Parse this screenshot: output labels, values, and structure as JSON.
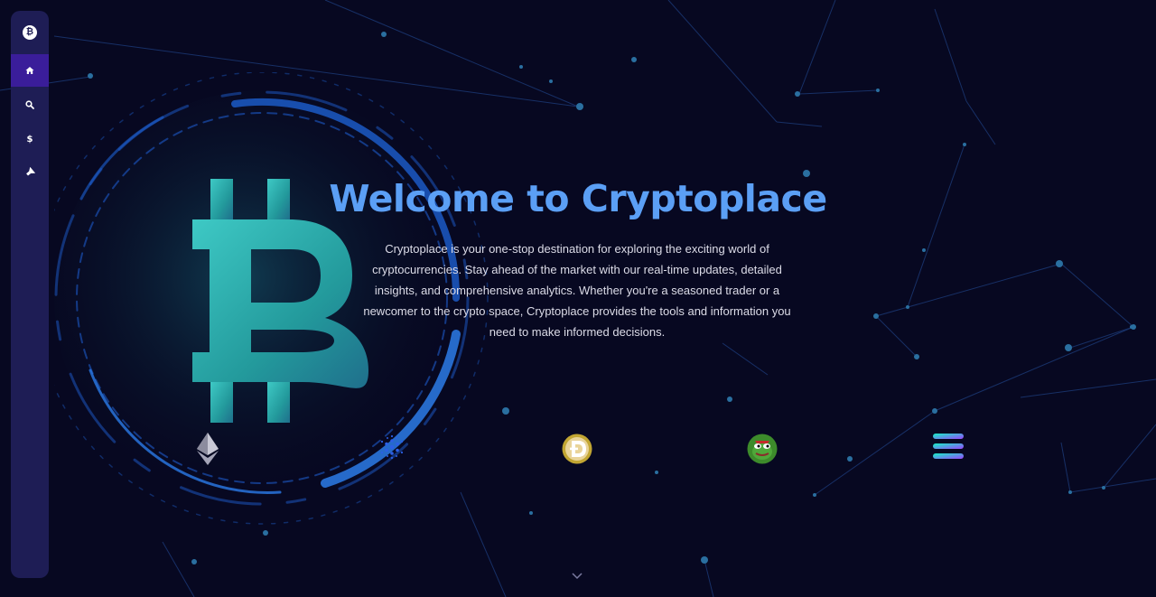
{
  "sidebar": {
    "logo": "bitcoin-icon",
    "items": [
      {
        "name": "home",
        "icon": "home-icon",
        "active": true
      },
      {
        "name": "search",
        "icon": "search-icon",
        "active": false
      },
      {
        "name": "prices",
        "icon": "dollar-icon",
        "active": false
      },
      {
        "name": "marketing",
        "icon": "megaphone-icon",
        "active": false
      }
    ]
  },
  "hero": {
    "title": "Welcome to Cryptoplace",
    "description": "Cryptoplace is your one-stop destination for exploring the exciting world of cryptocurrencies. Stay ahead of the market with our real-time updates, detailed insights, and comprehensive analytics. Whether you're a seasoned trader or a newcomer to the crypto space, Cryptoplace provides the tools and information you need to make informed decisions."
  },
  "coins": [
    "ethereum-icon",
    "cardano-icon",
    "dogecoin-icon",
    "pepe-icon",
    "solana-icon"
  ],
  "colors": {
    "background": "#070821",
    "sidebar": "#1e1d55",
    "active": "#3a1d9a",
    "accent": "#5b9ff5",
    "bitcoin": "#2fb5b0"
  }
}
